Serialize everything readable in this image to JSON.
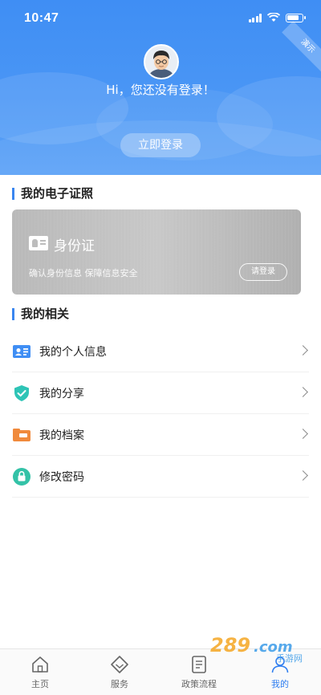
{
  "status_bar": {
    "time": "10:47"
  },
  "header": {
    "corner_tag": "演示",
    "greeting": "Hi，您还没有登录！",
    "login_button": "立即登录"
  },
  "certificates": {
    "title": "我的电子证照",
    "card": {
      "name": "身份证",
      "description": "确认身份信息 保障信息安全",
      "button": "请登录"
    }
  },
  "related": {
    "title": "我的相关",
    "items": [
      {
        "label": "我的个人信息",
        "icon": "id-card-icon"
      },
      {
        "label": "我的分享",
        "icon": "shield-check-icon"
      },
      {
        "label": "我的档案",
        "icon": "archive-icon"
      },
      {
        "label": "修改密码",
        "icon": "lock-icon"
      }
    ]
  },
  "tabbar": {
    "items": [
      {
        "label": "主页",
        "icon": "home-icon"
      },
      {
        "label": "服务",
        "icon": "diamond-icon"
      },
      {
        "label": "政策流程",
        "icon": "document-icon"
      },
      {
        "label": "我的",
        "icon": "user-icon"
      }
    ],
    "active_index": 3
  },
  "watermark": {
    "text": "289.com",
    "subtext": "手游网"
  },
  "colors": {
    "primary": "#3f8ef4",
    "active_tab": "#2f7ef0"
  }
}
